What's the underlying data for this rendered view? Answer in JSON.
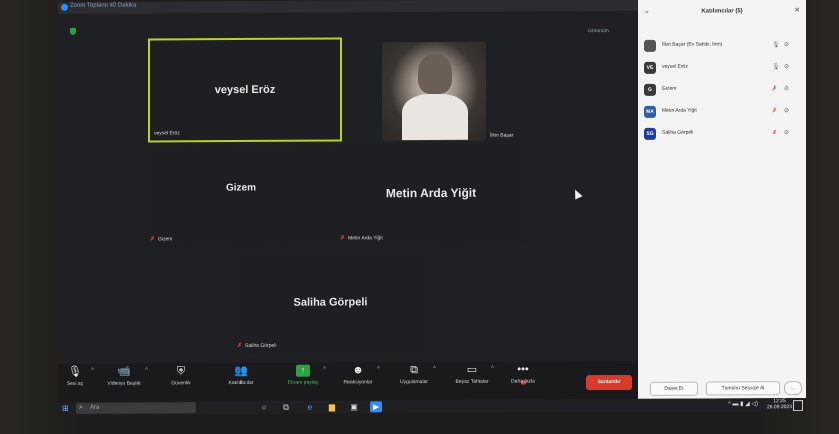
{
  "window": {
    "title": "Zoom Toplantı 40 Dakika"
  },
  "view": {
    "label": "Görünüm"
  },
  "tiles": [
    {
      "name": "veysel Eröz",
      "label": "veysel Eröz"
    },
    {
      "label": "İlkin Başar"
    },
    {
      "name": "Gizem",
      "label": "Gizem"
    },
    {
      "name": "Metin Arda Yiğit",
      "label": "Metin Arda Yiğit"
    },
    {
      "name": "Saliha Görpeli",
      "label": "Saliha Görpeli"
    }
  ],
  "toolbar": {
    "audio": "Sesi aç",
    "video": "Videoyu Başlat",
    "security": "Güvenlik",
    "participants": "Katılımcılar",
    "participants_count": "5",
    "share": "Ekranı paylaş",
    "reactions": "Reaksiyonlar",
    "apps": "Uygulamalar",
    "whiteboard": "Beyaz Tahtalar",
    "more": "Daha fazla",
    "end": "Sonlandır"
  },
  "panel": {
    "title": "Katılımcılar (5)",
    "participants": [
      {
        "initials": "",
        "name": "İlkin Başar (Ev Sahibi, ben)",
        "color": "#555555"
      },
      {
        "initials": "VE",
        "name": "veysel Eröz",
        "color": "#3a3a3a"
      },
      {
        "initials": "G",
        "name": "Gizem",
        "color": "#3a3a3a"
      },
      {
        "initials": "MA",
        "name": "Metin Arda Yiğit",
        "color": "#2d5fa8"
      },
      {
        "initials": "SG",
        "name": "Saliha Görpeli",
        "color": "#1f3fa0"
      }
    ],
    "invite": "Davet Et",
    "mute_all": "Tümünü Sessize Al",
    "more": "..."
  },
  "taskbar": {
    "search_placeholder": "Ara",
    "time": "12:25",
    "date": "26.09.2023"
  },
  "colors": {
    "active_speaker": "#b8d12b",
    "end_button": "#d93a2b",
    "zoom_blue": "#2d8cff"
  }
}
